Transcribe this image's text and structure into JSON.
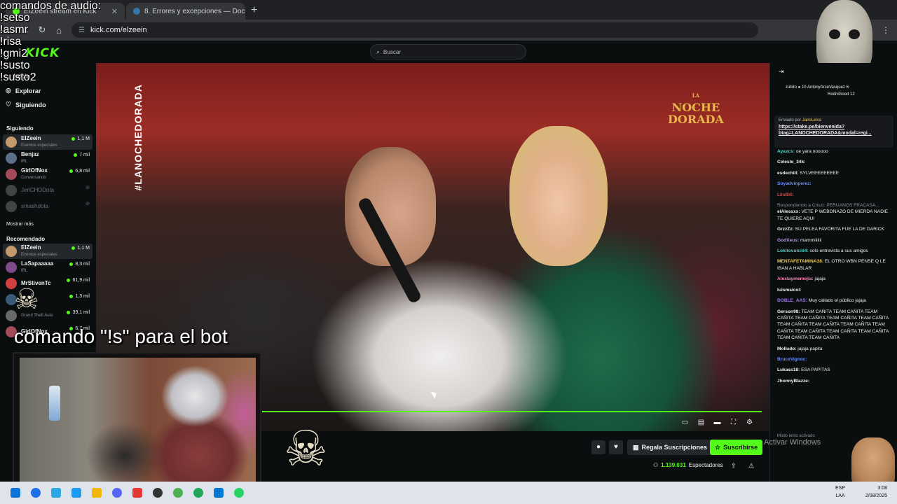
{
  "browser": {
    "tabs": [
      {
        "label": "EIZeein stream en Kick",
        "active": true
      },
      {
        "label": "8. Errores y excepciones — Doc",
        "active": false
      }
    ],
    "new_tab": "+",
    "url": "kick.com/elzeein"
  },
  "kick": {
    "logo": "KICK",
    "search_placeholder": "Buscar"
  },
  "overlay": {
    "commands_text": "comandos de audio:\n!setso\n!asmr\n!risa\n!gmi2\n!susto\n!susto2",
    "bot_text": "comando \"!s\" para el bot"
  },
  "sidebar": {
    "nav": {
      "home": "Inicio",
      "browse": "Explorar",
      "following": "Siguiendo"
    },
    "following_title": "Siguiendo",
    "following": [
      {
        "name": "ElZeein",
        "category": "Eventos especiales",
        "viewers": "1,1 M",
        "avatar": "#c49a6c",
        "active": true
      },
      {
        "name": "Benjaz",
        "category": "IRL",
        "viewers": "7 mil",
        "avatar": "#5a6f8a"
      },
      {
        "name": "GirlOfNox",
        "category": "Conversando",
        "viewers": "6,8 mil",
        "avatar": "#a44b5a"
      },
      {
        "name": "JeriCHDDota",
        "category": "",
        "viewers": "",
        "avatar": "#444",
        "offline": true
      },
      {
        "name": "smashdota",
        "category": "",
        "viewers": "",
        "avatar": "#444",
        "offline": true
      }
    ],
    "show_more": "Mostrar más",
    "recommended_title": "Recomendado",
    "recommended": [
      {
        "name": "ElZeein",
        "category": "Eventos especiales",
        "viewers": "1,1 M",
        "avatar": "#c49a6c",
        "active": true
      },
      {
        "name": "LaSapaaaaa",
        "category": "IRL",
        "viewers": "8,3 mil",
        "avatar": "#7d4a8a"
      },
      {
        "name": "MrStivenTc",
        "category": "",
        "viewers": "61,9 mil",
        "avatar": "#d04040"
      },
      {
        "name": "",
        "category": "",
        "viewers": "1,3 mil",
        "avatar": "#3a5a7a"
      },
      {
        "name": "",
        "category": "Grand Theft Auto",
        "viewers": "39,1 mil",
        "avatar": "#6a6a6a"
      },
      {
        "name": "GirlOfNox",
        "category": "",
        "viewers": "6,7 mil",
        "avatar": "#a44b5a"
      }
    ]
  },
  "video": {
    "hashtag": "#LANOCHEDORADA",
    "logo_small": "LA",
    "logo_line1": "NOCHE",
    "logo_line2": "DORADA",
    "progress": 1.0
  },
  "below": {
    "gift_label": "Regala Suscripciones",
    "subscribe_label": "Suscribirse",
    "viewers_count": "1.139.031",
    "viewers_label": "Espectadores"
  },
  "chat": {
    "pinned_top": [
      "zubito ● 10 AntonyArceVasquez 6",
      "RodriiGood 12"
    ],
    "pinned_by": "Enviado por",
    "pinned_user": "JairoLeiva",
    "pinned_link": "https://stake.pe/bienvenida?btag=LANOCHEDORADA&modal=regi...",
    "messages": [
      {
        "user": "Ayaxcs:",
        "color": "#4fd1c5",
        "text": "oe yara nooooo"
      },
      {
        "user": "Celeste_34k:",
        "color": "#efeff1",
        "text": ""
      },
      {
        "user": "esdechill:",
        "color": "#efeff1",
        "text": "SYLVEEEEEEEEE"
      },
      {
        "user": "Soyadvinperez:",
        "color": "#6b8cff",
        "text": ""
      },
      {
        "user": "L0sBi0:",
        "color": "#e53e3e",
        "text": ""
      },
      {
        "reply": "Respondiendo a Criszt: PERUANOS FRACASA...",
        "user": "elAlessxx:",
        "color": "#efeff1",
        "text": "VETE P WEBONAZO DE MIERDA NADIE TE QUIERE AQUI"
      },
      {
        "user": "GrzzZz:",
        "color": "#efeff1",
        "text": "SU PELEA FAVORITA FUE LA DE DARICK"
      },
      {
        "user": "GodXeus:",
        "color": "#b794f4",
        "text": "mammiiiiiii"
      },
      {
        "user": "Lokitosuicid4:",
        "color": "#4fd1c5",
        "text": "solo entrevista a sus amigos"
      },
      {
        "user": "MENTAFETAMINA38:",
        "color": "#ecc94b",
        "text": "EL OTRO WBN PENSE Q LE IBAN A HABLAR"
      },
      {
        "user": "Alexlaymemejia:",
        "color": "#f687b3",
        "text": "jajaja"
      },
      {
        "user": "luismaicol:",
        "color": "#efeff1",
        "text": ""
      },
      {
        "user": "DOBLE_AAS:",
        "color": "#9f7aea",
        "text": "Muy callado el público jajaja"
      },
      {
        "user": "Gerson98:",
        "color": "#efeff1",
        "text": "TEAM CAÑITA TEAM CAÑITA TEAM CAÑITA TEAM CAÑITA TEAM CAÑITA TEAM CAÑITA TEAM CAÑITA TEAM CAÑITA TEAM CAÑITA TEAM CAÑITA TEAM CAÑITA TEAM CAÑITA TEAM CAÑITA TEAM CAÑITA TEAM CAÑITA"
      },
      {
        "user": "Molludo:",
        "color": "#efeff1",
        "text": "jajaja papita"
      },
      {
        "user": "BruceVignoc:",
        "color": "#6b8cff",
        "text": ""
      },
      {
        "user": "Lukass18:",
        "color": "#efeff1",
        "text": "ESA PAPITAS"
      },
      {
        "user": "JhonnyBlazze:",
        "color": "#efeff1",
        "text": ""
      }
    ],
    "slow_mode": "Modo lento activado"
  },
  "taskbar": {
    "lang1": "ESP",
    "lang2": "LAA",
    "time": "3:08",
    "date": "2/08/2025",
    "watermark": "Activar Windows"
  },
  "colors": {
    "kick_green": "#53fc18",
    "bg": "#0b0e0f"
  }
}
